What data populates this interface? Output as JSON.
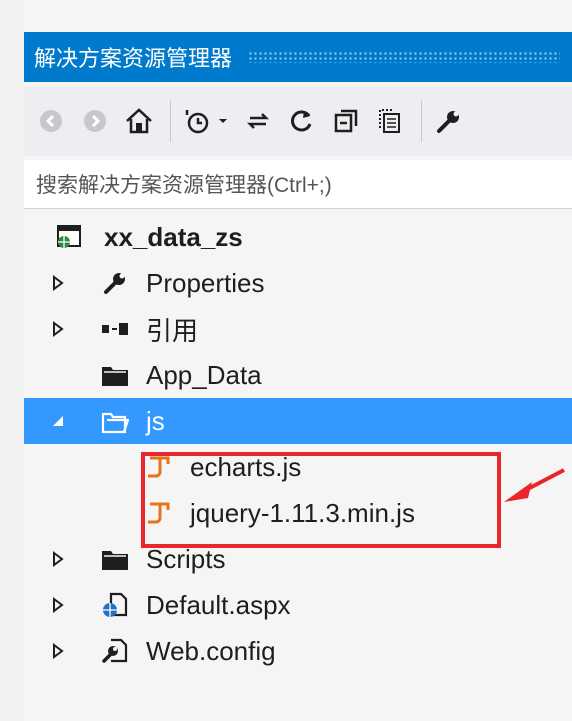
{
  "window": {
    "title": "解决方案资源管理器"
  },
  "toolbar": {
    "buttons": [
      {
        "name": "back-icon"
      },
      {
        "name": "forward-icon"
      },
      {
        "name": "home-icon"
      },
      {
        "name": "pending-changes-icon"
      },
      {
        "name": "dropdown-caret-icon"
      },
      {
        "name": "sync-icon"
      },
      {
        "name": "refresh-icon"
      },
      {
        "name": "collapse-all-icon"
      },
      {
        "name": "show-all-files-icon"
      },
      {
        "name": "properties-wrench-icon"
      }
    ]
  },
  "search": {
    "placeholder": "搜索解决方案资源管理器(Ctrl+;)"
  },
  "tree": {
    "project": "xx_data_zs",
    "items": [
      {
        "label": "Properties",
        "icon": "wrench-icon",
        "expandable": true
      },
      {
        "label": "引用",
        "icon": "references-icon",
        "expandable": true
      },
      {
        "label": "App_Data",
        "icon": "folder-icon",
        "expandable": false
      },
      {
        "label": "js",
        "icon": "open-folder-icon",
        "expanded": true,
        "selected": true
      },
      {
        "label": "echarts.js",
        "icon": "js-file-icon"
      },
      {
        "label": "jquery-1.11.3.min.js",
        "icon": "js-file-icon"
      },
      {
        "label": "Scripts",
        "icon": "folder-icon",
        "expandable": true
      },
      {
        "label": "Default.aspx",
        "icon": "aspx-file-icon",
        "expandable": true
      },
      {
        "label": "Web.config",
        "icon": "config-file-icon",
        "expandable": true
      }
    ]
  },
  "colors": {
    "accent": "#007acc",
    "selection": "#3399ff",
    "highlight": "#e8262b",
    "js_file": "#e8741a"
  }
}
